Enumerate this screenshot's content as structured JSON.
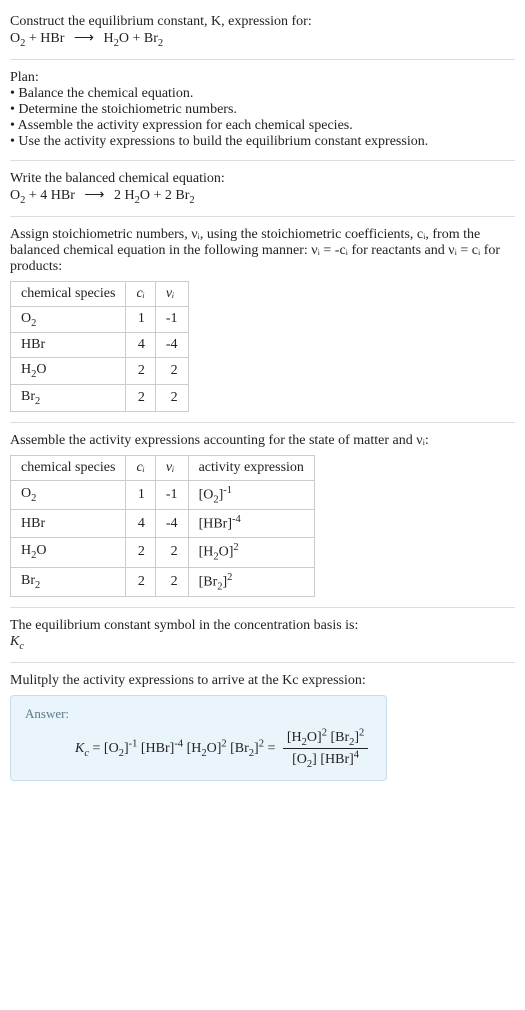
{
  "chart_data": [
    {
      "type": "table",
      "title": "Stoichiometric numbers",
      "series": [
        {
          "name": "O2",
          "values": [
            1,
            -1
          ]
        },
        {
          "name": "HBr",
          "values": [
            4,
            -4
          ]
        },
        {
          "name": "H2O",
          "values": [
            2,
            2
          ]
        },
        {
          "name": "Br2",
          "values": [
            2,
            2
          ]
        }
      ],
      "categories": [
        "c_i",
        "ν_i"
      ]
    },
    {
      "type": "table",
      "title": "Activity expressions",
      "series": [
        {
          "name": "O2",
          "values": [
            1,
            -1,
            "[O2]^-1"
          ]
        },
        {
          "name": "HBr",
          "values": [
            4,
            -4,
            "[HBr]^-4"
          ]
        },
        {
          "name": "H2O",
          "values": [
            2,
            2,
            "[H2O]^2"
          ]
        },
        {
          "name": "Br2",
          "values": [
            2,
            2,
            "[Br2]^2"
          ]
        }
      ],
      "categories": [
        "c_i",
        "ν_i",
        "activity expression"
      ]
    }
  ],
  "s1": {
    "line1": "Construct the equilibrium constant, K, expression for:",
    "eq_l1": "O",
    "eq_l2": " + HBr",
    "eq_r1": "H",
    "eq_r2": "O + Br"
  },
  "plan": {
    "title": "Plan:",
    "b1": "• Balance the chemical equation.",
    "b2": "• Determine the stoichiometric numbers.",
    "b3": "• Assemble the activity expression for each chemical species.",
    "b4": "• Use the activity expressions to build the equilibrium constant expression."
  },
  "s2": {
    "line1": "Write the balanced chemical equation:",
    "eq_l1": "O",
    "eq_l2": " + 4 HBr",
    "eq_r1a": "2 H",
    "eq_r1b": "O + 2 Br"
  },
  "s3": {
    "line1": "Assign stoichiometric numbers, νᵢ, using the stoichiometric coefficients, cᵢ, from the balanced chemical equation in the following manner: νᵢ = -cᵢ for reactants and νᵢ = cᵢ for products:"
  },
  "t1": {
    "h1": "chemical species",
    "h2": "cᵢ",
    "h3": "νᵢ",
    "r1c1": "O",
    "r1c2": "1",
    "r1c3": "-1",
    "r2c1": "HBr",
    "r2c2": "4",
    "r2c3": "-4",
    "r3c1": "H",
    "r3c2": "2",
    "r3c3": "2",
    "r4c1": "Br",
    "r4c2": "2",
    "r4c3": "2"
  },
  "s4": {
    "line1": "Assemble the activity expressions accounting for the state of matter and νᵢ:"
  },
  "t2": {
    "h1": "chemical species",
    "h2": "cᵢ",
    "h3": "νᵢ",
    "h4": "activity expression",
    "r1c1": "O",
    "r1c2": "1",
    "r1c3": "-1",
    "r1a": "[O",
    "r1b": "]",
    "r2c1": "HBr",
    "r2c2": "4",
    "r2c3": "-4",
    "r2a": "[HBr]",
    "r3c1": "H",
    "r3c2": "2",
    "r3c3": "2",
    "r3a": "[H",
    "r3b": "O]",
    "r4c1": "Br",
    "r4c2": "2",
    "r4c3": "2",
    "r4a": "[Br",
    "r4b": "]"
  },
  "s5": {
    "line1": "The equilibrium constant symbol in the concentration basis is:",
    "line2": "K"
  },
  "s6": {
    "line1": "Mulitply the activity expressions to arrive at the Kc expression:"
  },
  "answer": {
    "label": "Answer:",
    "Kc": "K",
    "eq": " = ",
    "lb_o2": "[O",
    "rb": "]",
    "lb_hbr": "[HBr]",
    "lb_h2o_a": "[H",
    "lb_h2o_b": "O]",
    "lb_br2": "[Br",
    "eq2": " = "
  },
  "sub2": "2",
  "exp_neg1": "-1",
  "exp_neg4": "-4",
  "exp_2": "2",
  "exp_4": "4",
  "subc": "c",
  "arrow": "⟶"
}
